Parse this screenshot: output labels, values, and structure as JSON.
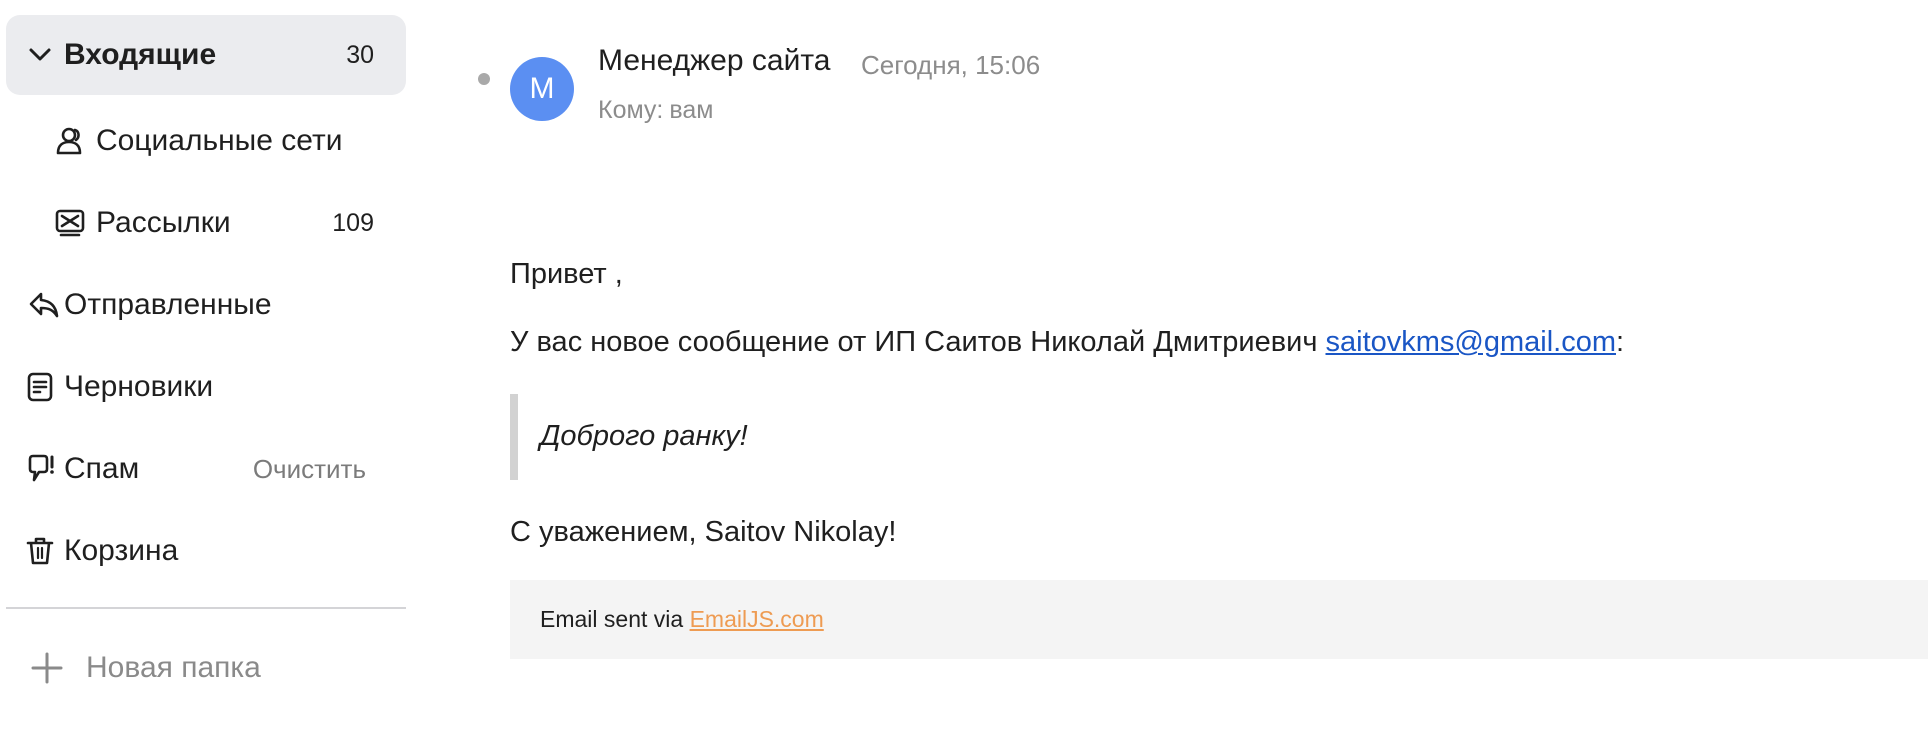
{
  "sidebar": {
    "items": [
      {
        "label": "Входящие",
        "count": "30",
        "icon": "chevron-down-icon"
      },
      {
        "label": "Социальные сети",
        "icon": "people-icon"
      },
      {
        "label": "Рассылки",
        "count": "109",
        "icon": "newsletter-icon"
      },
      {
        "label": "Отправленные",
        "icon": "reply-icon"
      },
      {
        "label": "Черновики",
        "icon": "draft-icon"
      },
      {
        "label": "Спам",
        "action": "Очистить",
        "icon": "spam-icon"
      },
      {
        "label": "Корзина",
        "icon": "trash-icon"
      }
    ],
    "new_folder": {
      "label": "Новая папка",
      "icon": "plus-icon"
    }
  },
  "message": {
    "avatar_letter": "М",
    "sender": "Менеджер сайта",
    "date": "Сегодня, 15:06",
    "to_label": "Кому:",
    "to_value": "вам",
    "greeting": "Привет ,",
    "intro_text": "У вас новое сообщение от ИП Саитов Николай Дмитриевич ",
    "intro_email": "saitovkms@gmail.com",
    "intro_suffix": ":",
    "quote": "Доброго ранку!",
    "sign_off": "С уважением, Saitov Nikolay!",
    "footer_text": "Email sent via ",
    "footer_link": "EmailJS.com"
  },
  "colors": {
    "avatar": "#5b8ff2",
    "active_item_bg": "#ebecef",
    "link": "#1a56c5",
    "footer_link": "#ee9b52"
  }
}
